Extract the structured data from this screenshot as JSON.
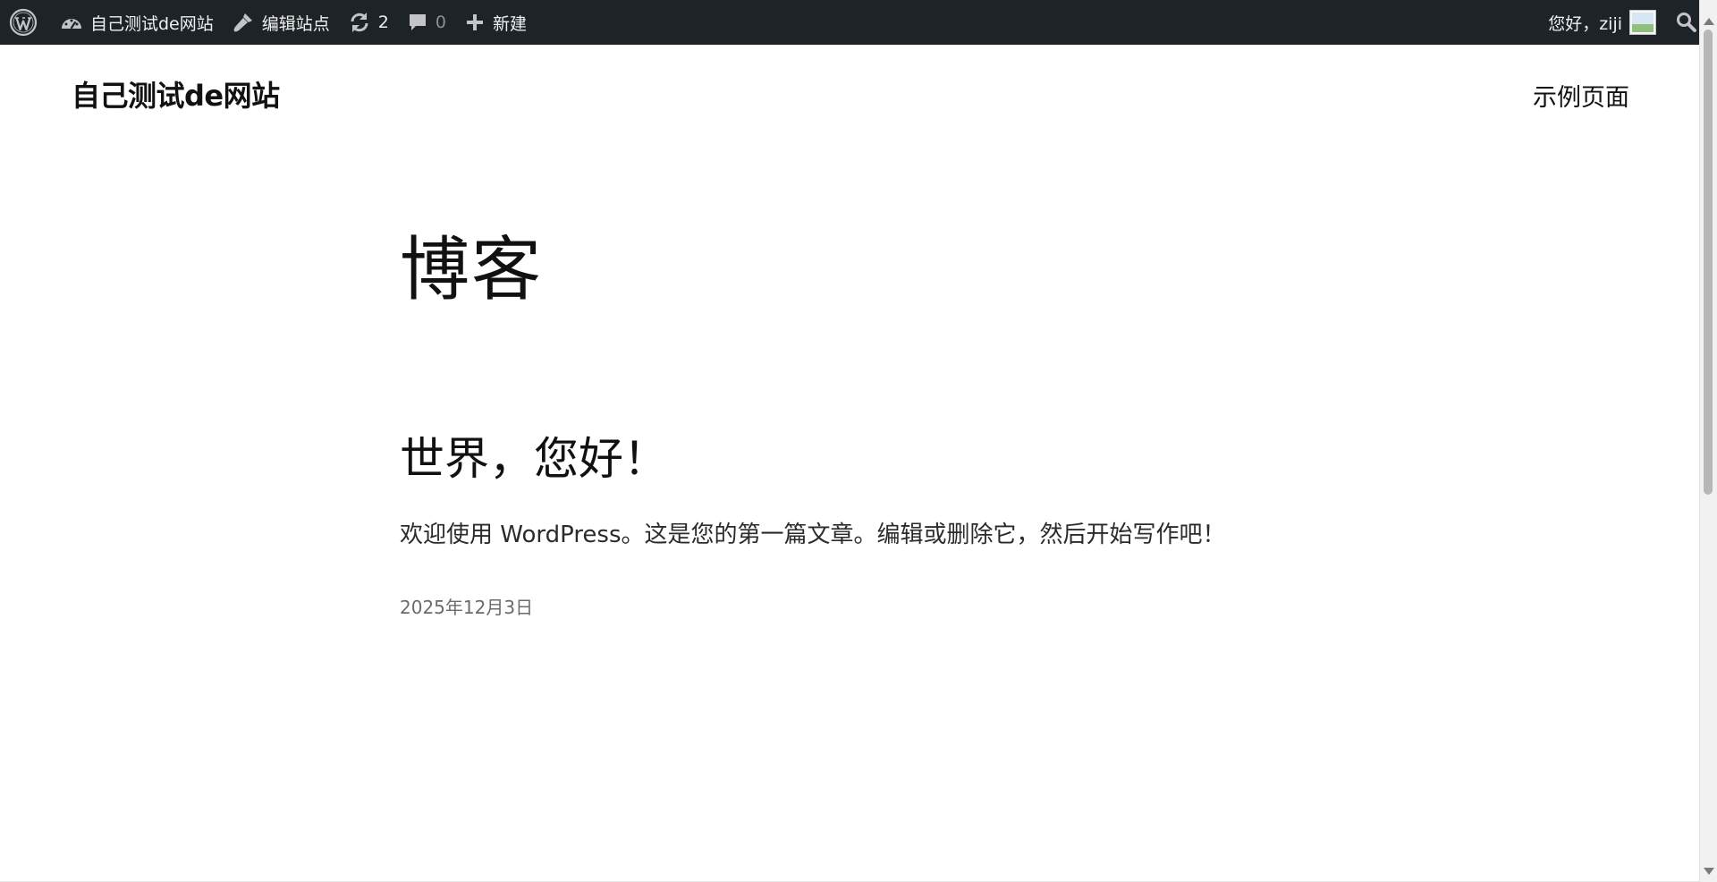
{
  "admin_bar": {
    "site_name": "自己测试de网站",
    "edit_site": "编辑站点",
    "updates_count": "2",
    "comments_count": "0",
    "new_label": "新建",
    "howdy": "您好，ziji"
  },
  "header": {
    "site_title": "自己测试de网站",
    "nav_items": [
      "示例页面"
    ]
  },
  "main": {
    "page_title": "博客",
    "posts": [
      {
        "title": "世界，您好！",
        "excerpt": "欢迎使用 WordPress。这是您的第一篇文章。编辑或删除它，然后开始写作吧！",
        "date": "2025年12月3日"
      }
    ]
  },
  "icons": {
    "wordpress": "wordpress-logo-icon",
    "dashboard": "dashboard-icon",
    "edit": "brush-icon",
    "updates": "refresh-icon",
    "comments": "comment-icon",
    "new": "plus-icon",
    "search": "search-icon"
  },
  "colors": {
    "admin_bar_bg": "#1d2327",
    "admin_bar_text": "#f0f0f1",
    "muted": "#8c8f94",
    "text": "#111111",
    "date": "#6b6b6b"
  }
}
